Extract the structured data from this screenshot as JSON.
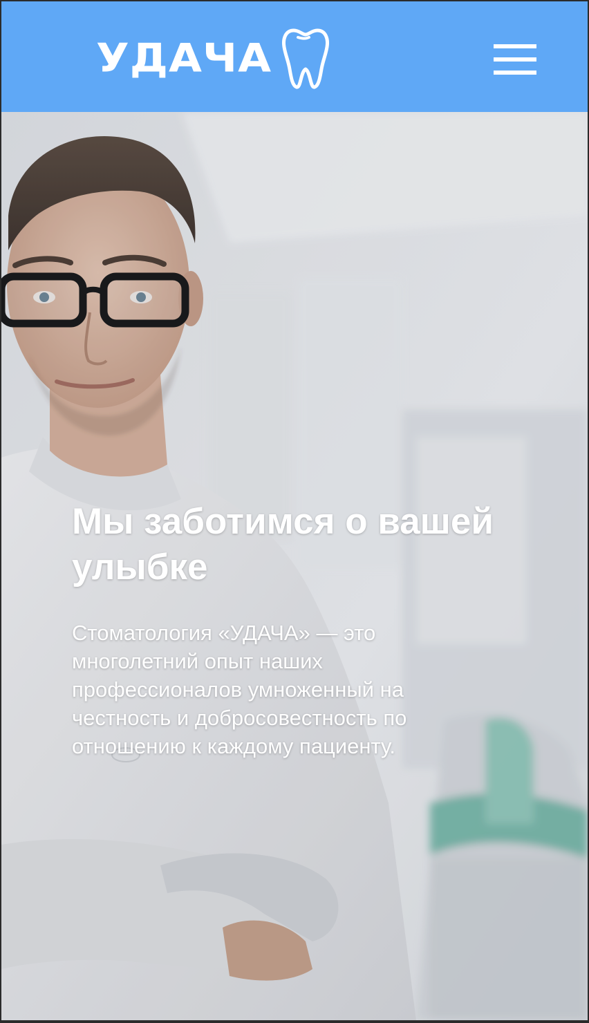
{
  "header": {
    "logo_text": "УДАЧА",
    "logo_icon": "tooth-icon",
    "menu_icon": "hamburger-menu-icon",
    "background_color": "#5fa8f6"
  },
  "hero": {
    "title": "Мы заботимся о вашей улыбке",
    "description": "Стоматология «УДАЧА» — это многолетний опыт наших профессионалов умноженный на честность и добросовестность по отношению к каждому пациенту.",
    "image": "doctor-photo"
  }
}
